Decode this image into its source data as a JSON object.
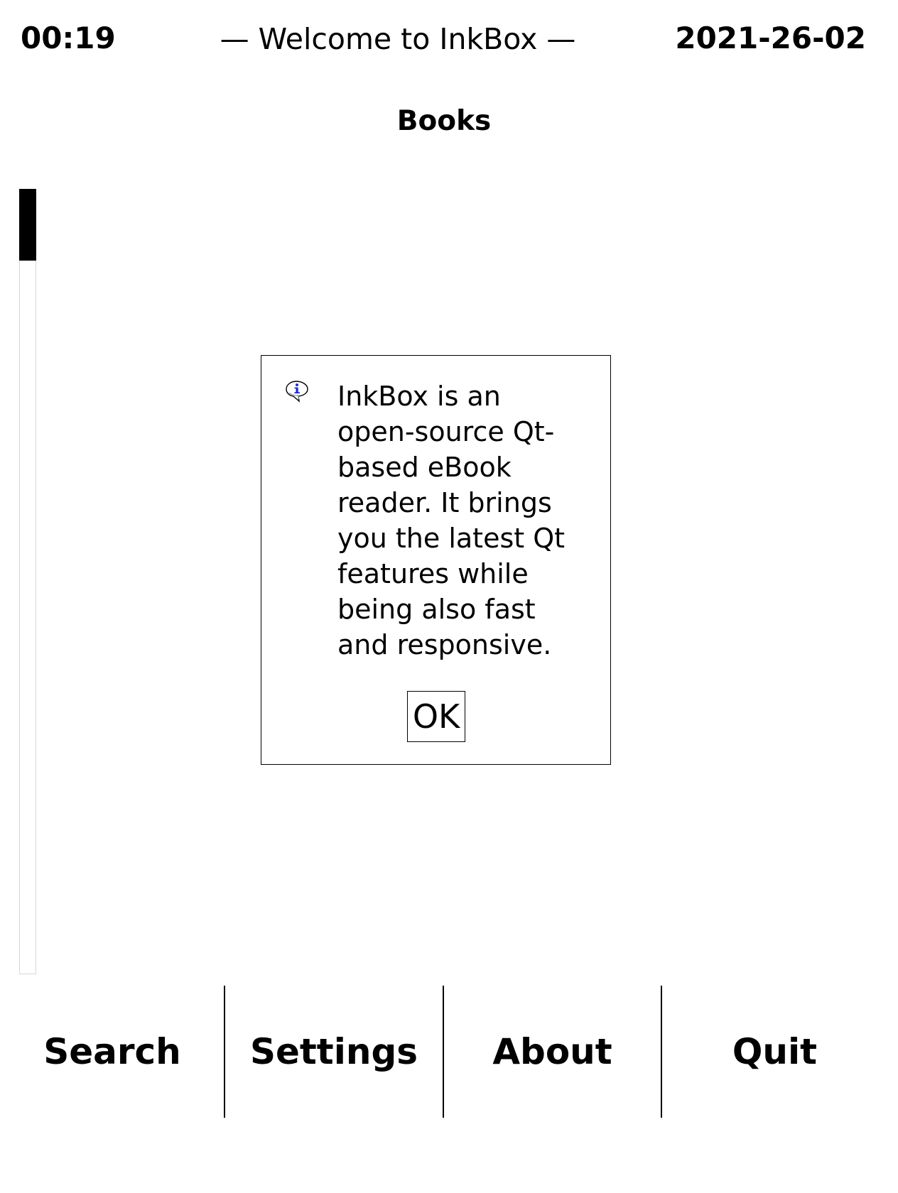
{
  "status_bar": {
    "time": "00:19",
    "welcome": "— Welcome to InkBox —",
    "date": "2021-26-02"
  },
  "section": {
    "title": "Books"
  },
  "dialog": {
    "icon": "info-icon",
    "message": "InkBox is an\nopen-source Qt-\nbased eBook\nreader. It brings\nyou the latest Qt\nfeatures while\nbeing also fast\nand responsive.",
    "ok_label": "OK"
  },
  "toolbar": {
    "search_label": "Search",
    "settings_label": "Settings",
    "about_label": "About",
    "quit_label": "Quit"
  },
  "colors": {
    "background": "#ffffff",
    "foreground": "#000000",
    "scroll_track_border": "#d6d6d6",
    "info_icon_blue": "#1a2bd8"
  }
}
